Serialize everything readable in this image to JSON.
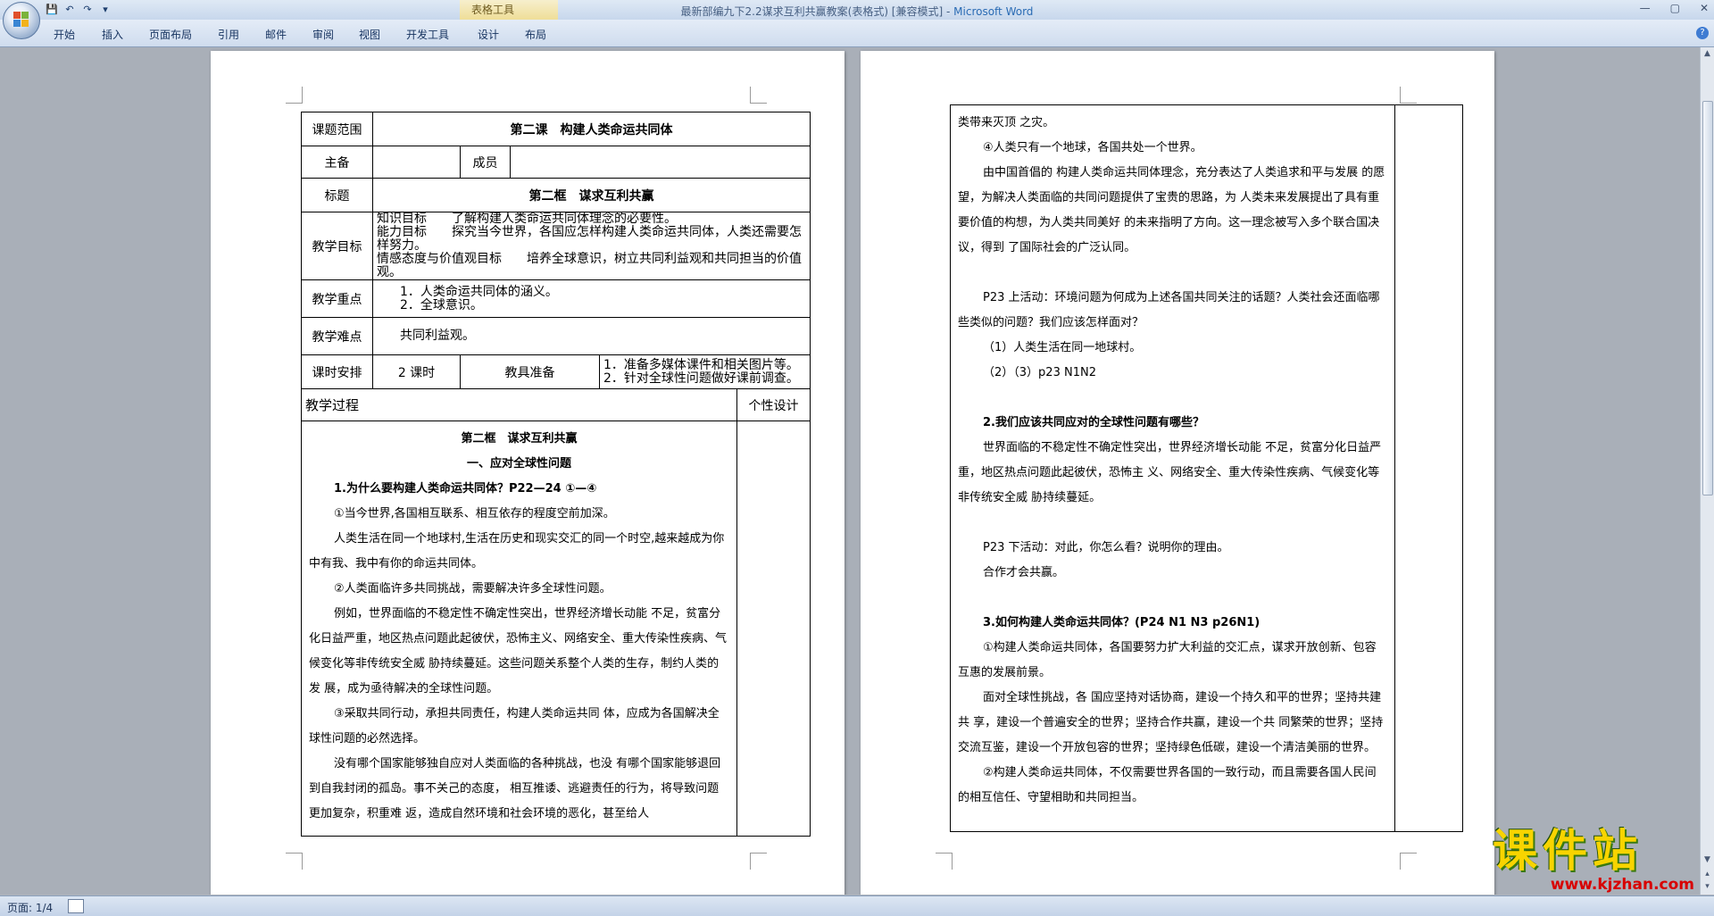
{
  "window": {
    "title": "最新部编九下2.2谋求互利共赢教案(表格式) [兼容模式]",
    "app_name": "Microsoft Word",
    "contextual_group": "表格工具",
    "controls": [
      "—",
      "▢",
      "✕"
    ]
  },
  "ribbon": {
    "tabs": [
      "开始",
      "插入",
      "页面布局",
      "引用",
      "邮件",
      "审阅",
      "视图",
      "开发工具",
      "设计",
      "布局"
    ]
  },
  "page1": {
    "r1_label": "课题范围",
    "r1_value": "第二课　构建人类命运共同体",
    "r2_label": "主备",
    "r2_member_label": "成员",
    "r3_label": "标题",
    "r3_value": "第二框　谋求互利共赢",
    "r4_label": "教学目标",
    "r4_lines": [
      "知识目标　　了解构建人类命运共同体理念的必要性。",
      "能力目标　　探究当今世界，各国应怎样构建人类命运共同体，人类还需要怎样努力。",
      "情感态度与价值观目标　　培养全球意识，树立共同利益观和共同担当的价值观。"
    ],
    "r5_label": "教学重点",
    "r5_lines": [
      "1．人类命运共同体的涵义。",
      "2．全球意识。"
    ],
    "r6_label": "教学难点",
    "r6_value": "共同利益观。",
    "r7_label": "课时安排",
    "r7_value": "2 课时",
    "r7_tool_label": "教具准备",
    "r7_tool_lines": [
      "1．准备多媒体课件和相关图片等。",
      "2．针对全球性问题做好课前调查。"
    ],
    "r8_label": "教学过程",
    "r8_side_label": "个性设计",
    "body": [
      {
        "t": "第二框　谋求互利共赢",
        "s": "c"
      },
      {
        "t": "一、应对全球性问题",
        "s": "c"
      },
      {
        "t": "1.为什么要构建人类命运共同体？P22—24 ①—④",
        "s": "b"
      },
      {
        "t": "①当今世界,各国相互联系、相互依存的程度空前加深。",
        "s": ""
      },
      {
        "t": "人类生活在同一个地球村,生活在历史和现实交汇的同一个时空,越来越成为你中有我、我中有你的命运共同体。",
        "s": ""
      },
      {
        "t": "②人类面临许多共同挑战，需要解决许多全球性问题。",
        "s": ""
      },
      {
        "t": "例如，世界面临的不稳定性不确定性突出，世界经济增长动能 不足，贫富分化日益严重，地区热点问题此起彼伏，恐怖主义、网络安全、重大传染性疾病、气候变化等非传统安全威 胁持续蔓延。这些问题关系整个人类的生存，制约人类的发 展，成为亟待解决的全球性问题。",
        "s": ""
      },
      {
        "t": "③采取共同行动，承担共同责任，构建人类命运共同 体，应成为各国解决全球性问题的必然选择。",
        "s": ""
      },
      {
        "t": "没有哪个国家能够独自应对人类面临的各种挑战，也没 有哪个国家能够退回到自我封闭的孤岛。事不关己的态度， 相互推诿、逃避责任的行为，将导致问题更加复杂，积重难 返，造成自然环境和社会环境的恶化，甚至给人",
        "s": ""
      }
    ]
  },
  "page2": {
    "body": [
      {
        "t": "类带来灭顶 之灾。",
        "s": "n"
      },
      {
        "t": "④人类只有一个地球，各国共处一个世界。",
        "s": ""
      },
      {
        "t": "由中国首倡的 构建人类命运共同体理念，充分表达了人类追求和平与发展 的愿望，为解决人类面临的共同问题提供了宝贵的思路，为 人类未来发展提出了具有重要价值的构想，为人类共同美好 的未来指明了方向。这一理念被写入多个联合国决议，得到 了国际社会的广泛认同。",
        "s": ""
      },
      {
        "t": "",
        "s": "blank"
      },
      {
        "t": "P23 上活动：环境问题为何成为上述各国共同关注的话题？人类社会还面临哪些类似的问题？我们应该怎样面对？",
        "s": ""
      },
      {
        "t": "（1）人类生活在同一地球村。",
        "s": ""
      },
      {
        "t": "（2）（3）p23 N1N2",
        "s": ""
      },
      {
        "t": "",
        "s": "blank"
      },
      {
        "t": "2.我们应该共同应对的全球性问题有哪些？",
        "s": "b"
      },
      {
        "t": "世界面临的不稳定性不确定性突出，世界经济增长动能 不足，贫富分化日益严重，地区热点问题此起彼伏，恐怖主 义、网络安全、重大传染性疾病、气候变化等非传统安全威 胁持续蔓延。",
        "s": ""
      },
      {
        "t": "",
        "s": "blank"
      },
      {
        "t": "P23 下活动：对此，你怎么看？说明你的理由。",
        "s": ""
      },
      {
        "t": "合作才会共赢。",
        "s": ""
      },
      {
        "t": "",
        "s": "blank"
      },
      {
        "t": "3.如何构建人类命运共同体？(P24 N1 N3 p26N1)",
        "s": "b"
      },
      {
        "t": "①构建人类命运共同体，各国要努力扩大利益的交汇点，谋求开放创新、包容互惠的发展前景。",
        "s": ""
      },
      {
        "t": "面对全球性挑战，各 国应坚持对话协商，建设一个持久和平的世界；坚持共建共 享，建设一个普遍安全的世界；坚持合作共赢，建设一个共 同繁荣的世界；坚持交流互鉴，建设一个开放包容的世界；坚持绿色低碳，建设一个清洁美丽的世界。",
        "s": ""
      },
      {
        "t": "②构建人类命运共同体，不仅需要世界各国的一致行动，而且需要各国人民间的相互信任、守望相助和共同担当。",
        "s": ""
      }
    ]
  },
  "status": {
    "page_label": "页面: 1/4"
  },
  "watermark": {
    "brand": "课件站",
    "url": "www.kjzhan.com"
  }
}
